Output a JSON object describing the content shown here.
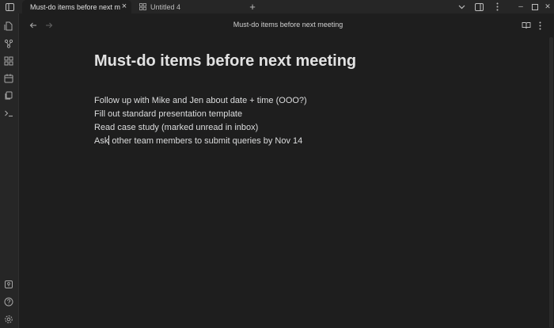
{
  "window": {
    "tabs": [
      {
        "label": "Must-do items before next meeting",
        "active": true
      },
      {
        "label": "Untitled 4",
        "active": false
      }
    ],
    "controls": {
      "minimize": "–",
      "maximize": "☐",
      "close": "✕"
    }
  },
  "ribbon": {
    "top_icons": [
      "open-quick-switcher-icon",
      "graph-view-icon",
      "canvas-icon",
      "daily-note-icon",
      "templates-icon",
      "command-palette-icon"
    ],
    "bottom_icons": [
      "help-vault-icon",
      "help-icon",
      "settings-icon"
    ]
  },
  "header": {
    "title": "Must-do items before next meeting"
  },
  "note": {
    "title": "Must-do items before next meeting",
    "lines": [
      "Follow up with Mike and Jen about date + time (OOO?)",
      "Fill out standard presentation template",
      "Read case study (marked unread in inbox)"
    ],
    "last_line_before_caret": "Ask",
    "last_line_after_caret": " other team members to submit queries by Nov 14"
  },
  "colors": {
    "background": "#1e1e1e",
    "chrome": "#262626",
    "text": "#dcddde",
    "muted": "#8a8a8a"
  }
}
